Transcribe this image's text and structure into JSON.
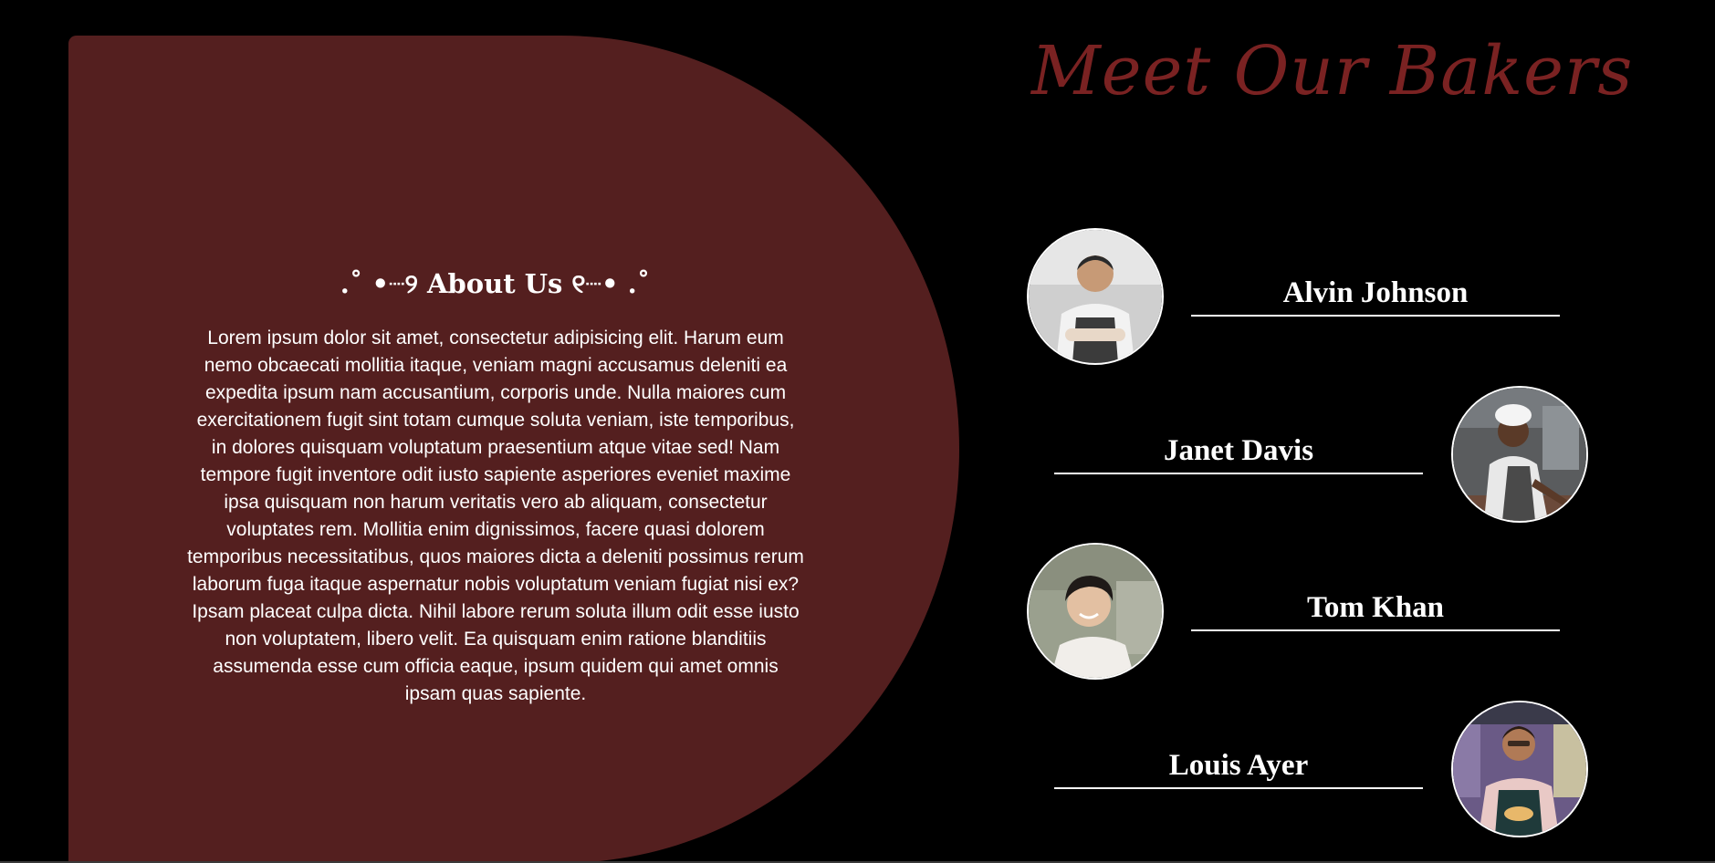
{
  "about": {
    "heading": ".˚ •┈୨ About Us ୧┈• .˚",
    "text": "Lorem ipsum dolor sit amet, consectetur adipisicing elit. Harum eum nemo obcaecati mollitia itaque, veniam magni accusamus deleniti ea expedita ipsum nam accusantium, corporis unde. Nulla maiores cum exercitationem fugit sint totam cumque soluta veniam, iste temporibus, in dolores quisquam voluptatum praesentium atque vitae sed! Nam tempore fugit inventore odit iusto sapiente asperiores eveniet maxime ipsa quisquam non harum veritatis vero ab aliquam, consectetur voluptates rem. Mollitia enim dignissimos, facere quasi dolorem temporibus necessitatibus, quos maiores dicta a deleniti possimus rerum laborum fuga itaque aspernatur nobis voluptatum veniam fugiat nisi ex? Ipsam placeat culpa dicta. Nihil labore rerum soluta illum odit esse iusto non voluptatem, libero velit. Ea quisquam enim ratione blanditiis assumenda esse cum officia eaque, ipsum quidem qui amet omnis ipsam quas sapiente."
  },
  "bakers": {
    "title": "Meet Our Bakers",
    "members": [
      {
        "name": "Alvin Johnson",
        "photo": "baker-photo-icon"
      },
      {
        "name": "Janet Davis",
        "photo": "baker-photo-icon"
      },
      {
        "name": "Tom Khan",
        "photo": "baker-photo-icon"
      },
      {
        "name": "Louis Ayer",
        "photo": "baker-photo-icon"
      }
    ]
  },
  "colors": {
    "background": "#000000",
    "panel": "#541f1f",
    "title": "#7a2222",
    "text": "#ffffff"
  }
}
